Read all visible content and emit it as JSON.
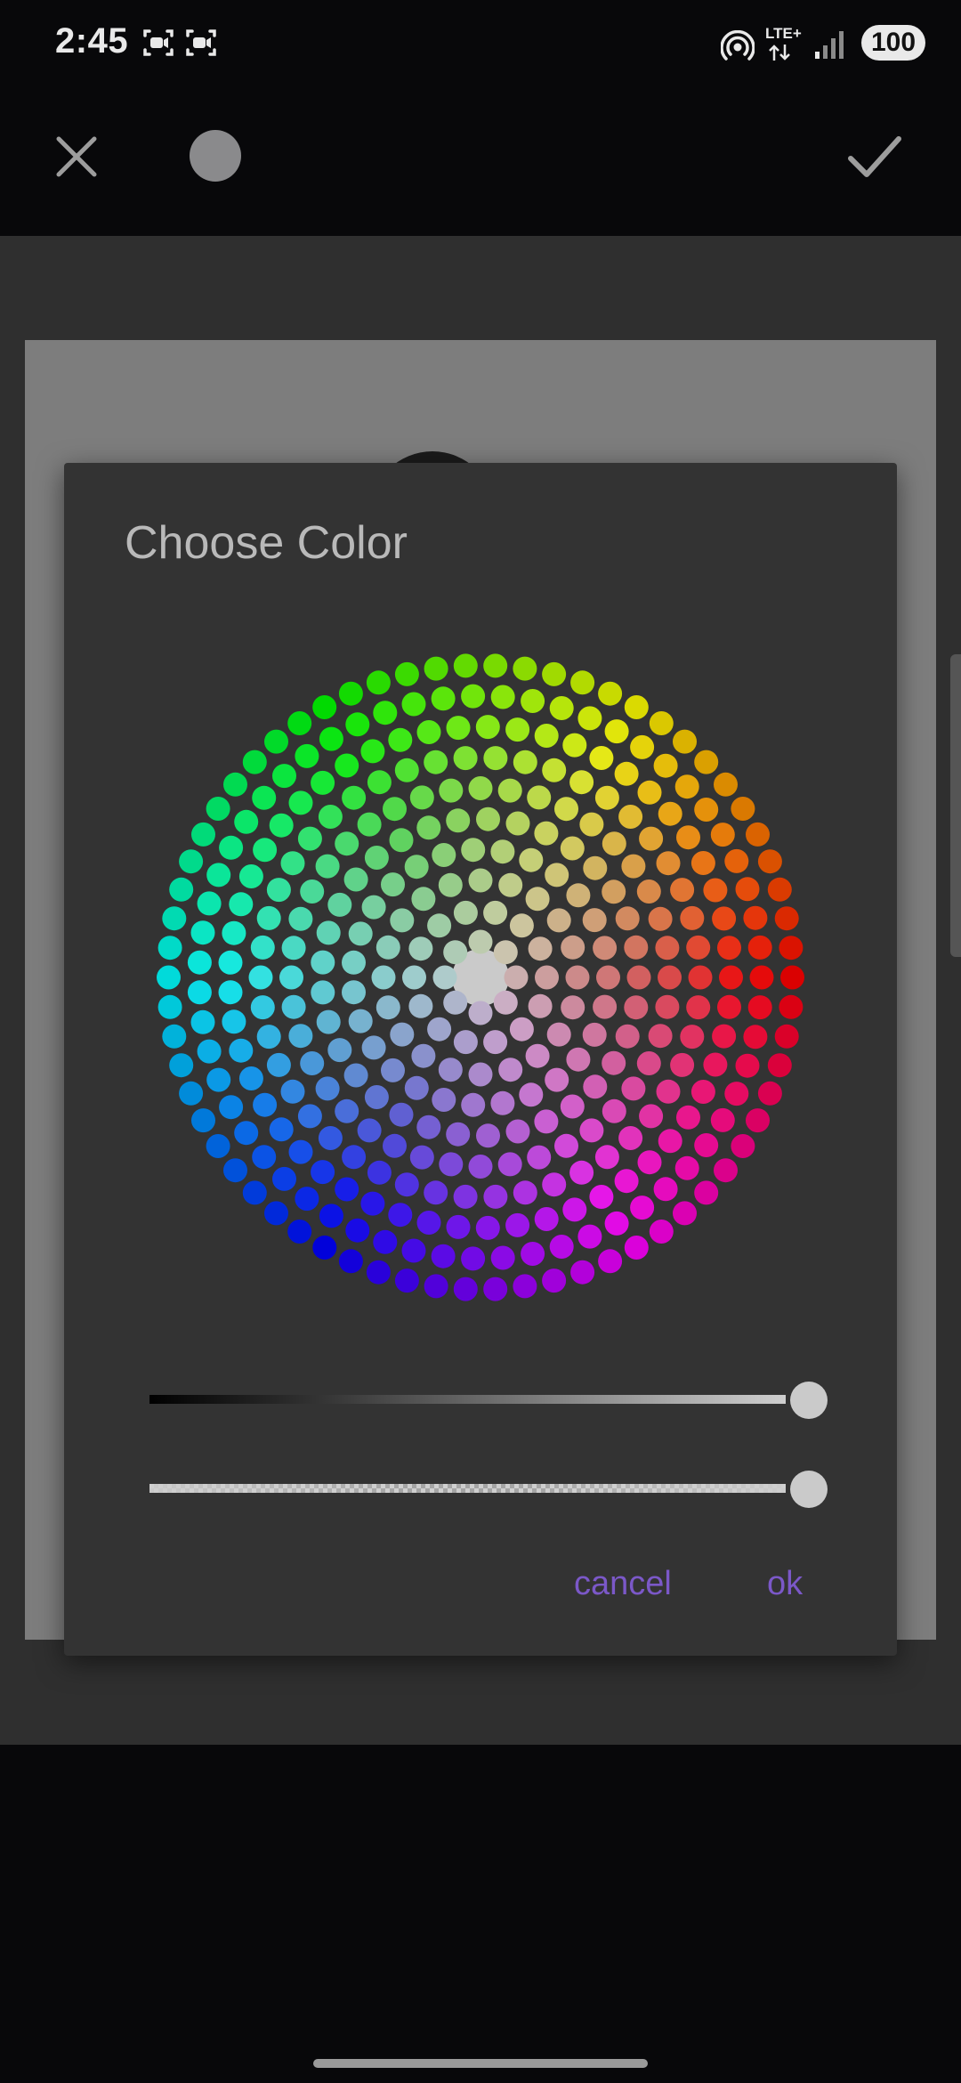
{
  "status_bar": {
    "time": "2:45",
    "network": "LTE+",
    "battery": "100",
    "icons": [
      "screen-record-icon",
      "screen-record-icon",
      "hotspot-icon",
      "lte-icon",
      "signal-icon",
      "battery-icon"
    ]
  },
  "toolbar": {
    "close_icon": "close-icon",
    "confirm_icon": "check-icon",
    "preview_color": "#8a8a8c"
  },
  "dialog": {
    "title": "Choose Color",
    "selected_color": "#cacaca",
    "lightness_slider": {
      "value": 1.0
    },
    "alpha_slider": {
      "value": 1.0
    },
    "buttons": {
      "cancel": "cancel",
      "ok": "ok"
    },
    "accent_color": "#7b58c8"
  }
}
